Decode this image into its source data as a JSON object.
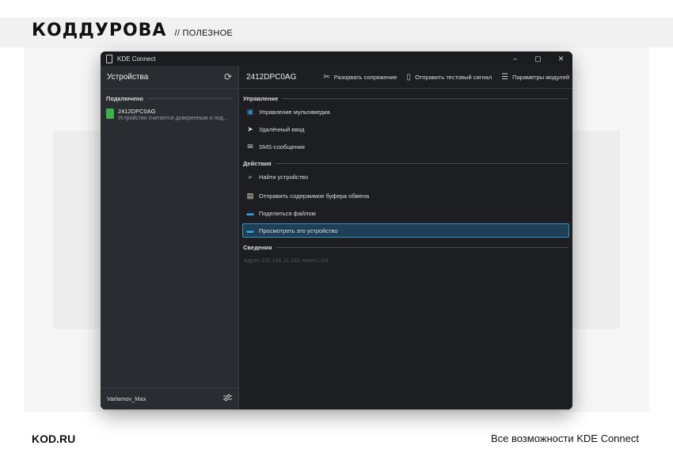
{
  "brand": {
    "logo": "КОДДУРОВА",
    "section": "// ПОЛЕЗНОЕ"
  },
  "footer": {
    "left": "KOD.RU",
    "right": "Все возможности KDE Connect"
  },
  "window": {
    "title": "KDE Connect",
    "controls": [
      "–",
      "▢",
      "✕"
    ]
  },
  "sidebar": {
    "title": "Устройства",
    "refresh_icon": "⟳",
    "section": "Подключено",
    "device": {
      "name": "2412DPC0AG",
      "status": "Устройство считается доверенным и под..."
    },
    "user": "Varlamov_Max",
    "settings_icon": "⚙"
  },
  "main": {
    "device_title": "2412DPC0AG",
    "toolbar": {
      "unpair": "Разорвать сопряжение",
      "ping": "Отправить тестовый сигнал",
      "plugins": "Параметры модулей"
    },
    "sections": {
      "control": "Управление",
      "actions": "Действия",
      "info": "Сведения"
    },
    "control_items": [
      {
        "label": "Управление мультимедиа",
        "icon": "media-icon"
      },
      {
        "label": "Удалённый ввод",
        "icon": "cursor-icon"
      },
      {
        "label": "SMS-сообщения",
        "icon": "sms-icon"
      }
    ],
    "action_items": [
      {
        "label": "Найти устройство",
        "icon": "search-icon"
      },
      {
        "label": "Отправить содержимое буфера обмена",
        "icon": "clipboard-icon"
      },
      {
        "label": "Поделиться файлом",
        "icon": "folder-icon"
      },
      {
        "label": "Просмотреть это устройство",
        "icon": "folder-icon"
      }
    ],
    "info_text": "Адрес 192.168.31.153 через LAN"
  },
  "colors": {
    "accent": "#3d8fc4",
    "device_green": "#3bb24a",
    "window_bg": "#1c1e21",
    "sidebar_bg": "#292c30"
  }
}
